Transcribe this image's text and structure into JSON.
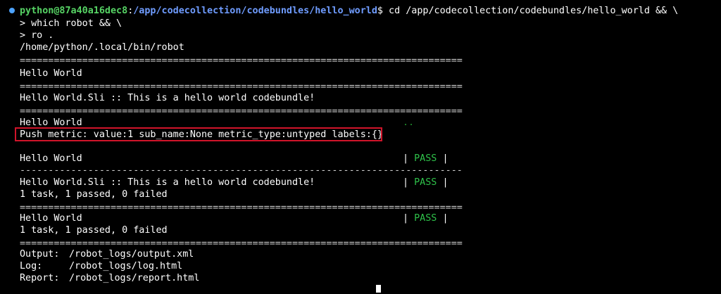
{
  "prompt": {
    "user_host": "python@87a40a16dec8",
    "separator": ":",
    "path": "/app/codecollection/codebundles/hello_world",
    "dollar": "$",
    "command": " cd /app/codecollection/codebundles/hello_world && \\"
  },
  "continuation": [
    "> which robot && \\",
    "> ro ."
  ],
  "robot_path": "/home/python/.local/bin/robot",
  "separators": {
    "double": "==============================================================================",
    "single": "------------------------------------------------------------------------------"
  },
  "suite": {
    "title": "Hello World",
    "sli_title": "Hello World.Sli :: This is a hello world codebundle!"
  },
  "test": {
    "name": "Hello World",
    "progress_dots": "..",
    "metric_line": "Push metric: value:1 sub_name:None metric_type:untyped labels:{}"
  },
  "results": {
    "test_row_name": "Hello World",
    "sli_row_name": "Hello World.Sli :: This is a hello world codebundle!",
    "sli_summary": "1 task, 1 passed, 0 failed",
    "suite_row_name": "Hello World",
    "suite_summary": "1 task, 1 passed, 0 failed",
    "status": "PASS",
    "pipe": "|"
  },
  "outputs": [
    {
      "label": "Output:",
      "value": "/robot_logs/output.xml"
    },
    {
      "label": "Log:",
      "value": "/robot_logs/log.html"
    },
    {
      "label": "Report:",
      "value": "/robot_logs/report.html"
    }
  ],
  "colors": {
    "background": "#000000",
    "user_host": "#56d364",
    "path": "#6f9cff",
    "pass": "#2fc24a",
    "highlight_border": "#d0142a"
  }
}
